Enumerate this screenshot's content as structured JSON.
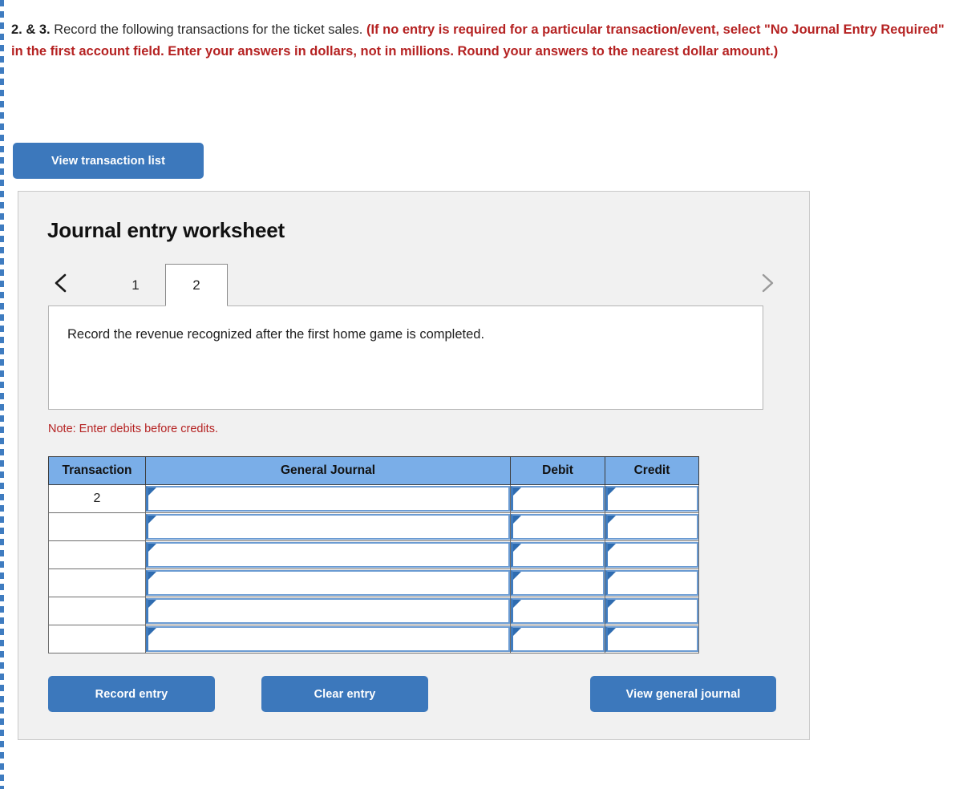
{
  "prompt": {
    "lead": "2. & 3.",
    "normal": " Record the following transactions for the ticket sales. ",
    "red": "(If no entry is required for a particular transaction/event, select \"No Journal Entry Required\" in the first account field. Enter your answers in dollars, not in millions. Round your answers to the nearest dollar amount.)"
  },
  "buttons": {
    "view_transaction_list": "View transaction list",
    "record_entry": "Record entry",
    "clear_entry": "Clear entry",
    "view_general_journal": "View general journal"
  },
  "worksheet": {
    "title": "Journal entry worksheet",
    "prev_arrow_icon": "chevron-left-icon",
    "next_arrow_icon": "chevron-right-icon",
    "tabs": [
      {
        "label": "1",
        "active": false
      },
      {
        "label": "2",
        "active": true
      }
    ],
    "description": "Record the revenue recognized after the first home game is completed.",
    "note": "Note: Enter debits before credits."
  },
  "table": {
    "headers": [
      "Transaction",
      "General Journal",
      "Debit",
      "Credit"
    ],
    "rows": [
      {
        "transaction": "2",
        "general_journal": "",
        "debit": "",
        "credit": ""
      },
      {
        "transaction": "",
        "general_journal": "",
        "debit": "",
        "credit": ""
      },
      {
        "transaction": "",
        "general_journal": "",
        "debit": "",
        "credit": ""
      },
      {
        "transaction": "",
        "general_journal": "",
        "debit": "",
        "credit": ""
      },
      {
        "transaction": "",
        "general_journal": "",
        "debit": "",
        "credit": ""
      },
      {
        "transaction": "",
        "general_journal": "",
        "debit": "",
        "credit": ""
      }
    ]
  },
  "colors": {
    "accent_blue": "#3c78bc",
    "header_blue": "#7aaee8",
    "alert_red": "#b52222",
    "panel_bg": "#f1f1f1"
  }
}
